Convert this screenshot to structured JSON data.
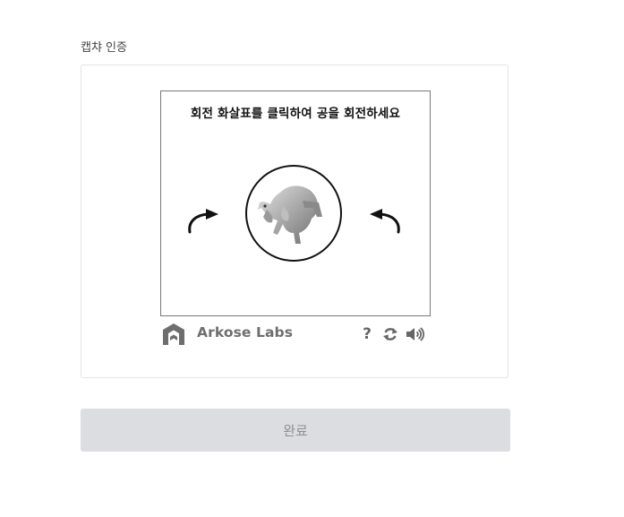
{
  "section": {
    "label": "캡챠 인증"
  },
  "challenge": {
    "instruction": "회전 화살표를 클릭하여 공을 회전하세요",
    "image_subject": "animal-figure"
  },
  "brand": {
    "name": "Arkose Labs",
    "logo_icon": "arkose-logo-icon"
  },
  "tools": {
    "help_label": "?",
    "help_icon": "question-icon",
    "refresh_icon": "refresh-icon",
    "audio_icon": "audio-icon"
  },
  "actions": {
    "submit_label": "완료",
    "submit_disabled": true
  },
  "colors": {
    "button_bg": "#dcdde0",
    "button_text": "#8d8f96",
    "card_border": "#e4e4e4",
    "frame_border": "#777777",
    "brand_gray": "#6e6e6e"
  }
}
